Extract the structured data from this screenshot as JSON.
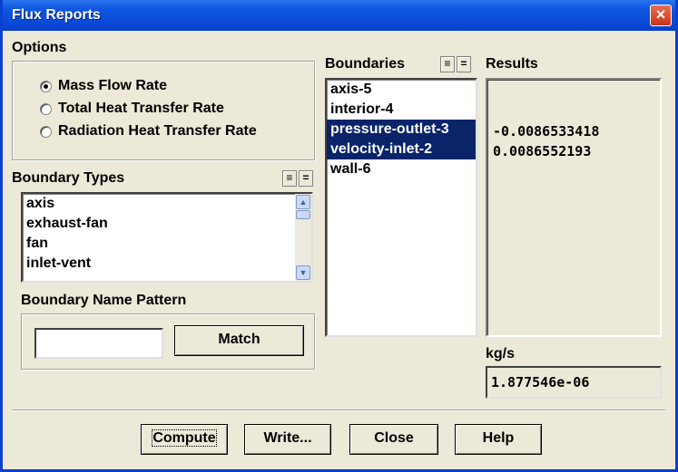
{
  "window": {
    "title": "Flux Reports",
    "close_icon": "×"
  },
  "options": {
    "label": "Options",
    "items": [
      {
        "label": "Mass Flow Rate",
        "selected": true
      },
      {
        "label": "Total Heat Transfer Rate",
        "selected": false
      },
      {
        "label": "Radiation Heat Transfer Rate",
        "selected": false
      }
    ]
  },
  "boundary_types": {
    "label": "Boundary Types",
    "items": [
      "axis",
      "exhaust-fan",
      "fan",
      "inlet-vent"
    ]
  },
  "pattern": {
    "label": "Boundary Name Pattern",
    "value": "",
    "match_label": "Match"
  },
  "boundaries": {
    "label": "Boundaries",
    "items": [
      {
        "label": "axis-5",
        "selected": false
      },
      {
        "label": "interior-4",
        "selected": false
      },
      {
        "label": "pressure-outlet-3",
        "selected": true
      },
      {
        "label": "velocity-inlet-2",
        "selected": true
      },
      {
        "label": "wall-6",
        "selected": false
      }
    ]
  },
  "results": {
    "label": "Results",
    "values": [
      "-0.0086533418",
      "0.0086552193"
    ],
    "unit": "kg/s",
    "net": "1.877546e-06"
  },
  "buttons": {
    "compute": "Compute",
    "write": "Write...",
    "close": "Close",
    "help": "Help"
  }
}
